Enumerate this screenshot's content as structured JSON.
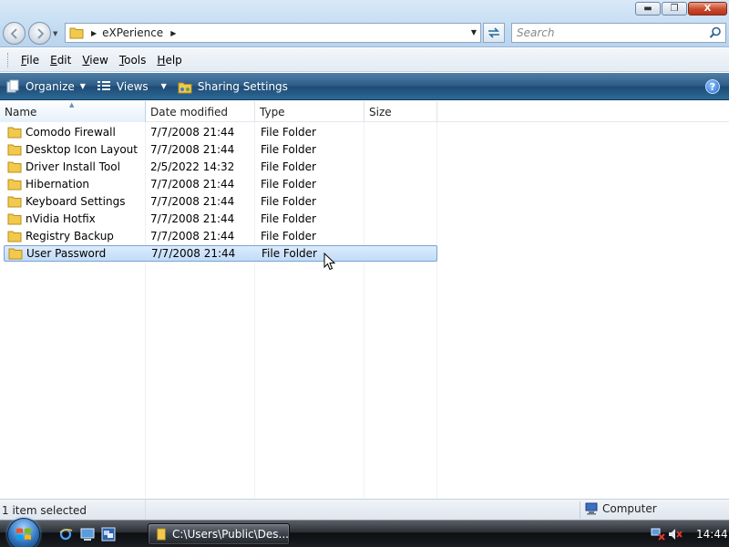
{
  "window": {
    "controls": {
      "minimize": "▬",
      "maximize": "❐",
      "close": "X"
    }
  },
  "address": {
    "crumb": "eXPerience"
  },
  "search": {
    "placeholder": "Search"
  },
  "menu": [
    {
      "label": "File",
      "accel": "F",
      "rest": "ile"
    },
    {
      "label": "Edit",
      "accel": "E",
      "rest": "dit"
    },
    {
      "label": "View",
      "accel": "V",
      "rest": "iew"
    },
    {
      "label": "Tools",
      "accel": "T",
      "rest": "ools"
    },
    {
      "label": "Help",
      "accel": "H",
      "rest": "elp"
    }
  ],
  "toolbar": {
    "organize": "Organize",
    "views": "Views",
    "sharing": "Sharing Settings",
    "help": "?"
  },
  "columns": {
    "name": "Name",
    "date": "Date modified",
    "type": "Type",
    "size": "Size"
  },
  "files": [
    {
      "name": "Comodo Firewall",
      "date": "7/7/2008 21:44",
      "type": "File Folder",
      "size": "",
      "selected": false
    },
    {
      "name": "Desktop Icon Layout",
      "date": "7/7/2008 21:44",
      "type": "File Folder",
      "size": "",
      "selected": false
    },
    {
      "name": "Driver Install Tool",
      "date": "2/5/2022 14:32",
      "type": "File Folder",
      "size": "",
      "selected": false
    },
    {
      "name": "Hibernation",
      "date": "7/7/2008 21:44",
      "type": "File Folder",
      "size": "",
      "selected": false
    },
    {
      "name": "Keyboard Settings",
      "date": "7/7/2008 21:44",
      "type": "File Folder",
      "size": "",
      "selected": false
    },
    {
      "name": "nVidia Hotfix",
      "date": "7/7/2008 21:44",
      "type": "File Folder",
      "size": "",
      "selected": false
    },
    {
      "name": "Registry Backup",
      "date": "7/7/2008 21:44",
      "type": "File Folder",
      "size": "",
      "selected": false
    },
    {
      "name": "User Password",
      "date": "7/7/2008 21:44",
      "type": "File Folder",
      "size": "",
      "selected": true
    }
  ],
  "status": {
    "selection": "1 item selected",
    "location": "Computer"
  },
  "taskbar": {
    "window_button": "C:\\Users\\Public\\Des...",
    "clock": "14:44"
  },
  "colors": {
    "selection_bg": "#c1dcf9",
    "selection_border": "#7da2ce",
    "command_bar": "#2c5b86",
    "folder": "#f2c94c"
  }
}
